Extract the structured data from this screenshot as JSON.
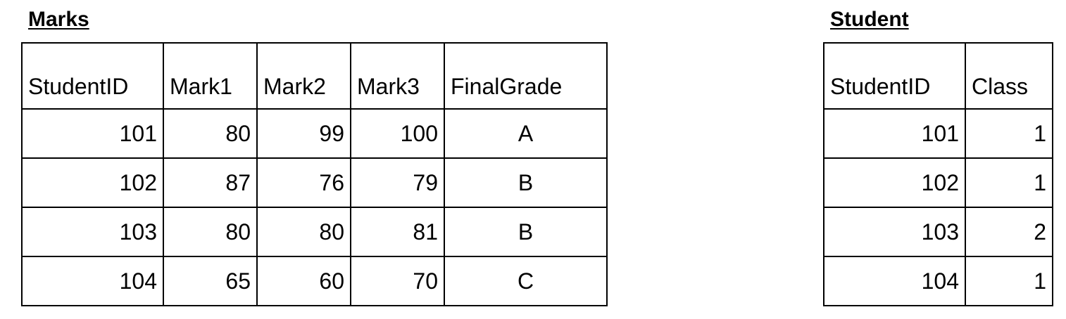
{
  "marks": {
    "title": "Marks",
    "headers": [
      "StudentID",
      "Mark1",
      "Mark2",
      "Mark3",
      "FinalGrade"
    ],
    "rows": [
      [
        "101",
        "80",
        "99",
        "100",
        "A"
      ],
      [
        "102",
        "87",
        "76",
        "79",
        "B"
      ],
      [
        "103",
        "80",
        "80",
        "81",
        "B"
      ],
      [
        "104",
        "65",
        "60",
        "70",
        "C"
      ]
    ]
  },
  "student": {
    "title": "Student",
    "headers": [
      "StudentID",
      "Class"
    ],
    "rows": [
      [
        "101",
        "1"
      ],
      [
        "102",
        "1"
      ],
      [
        "103",
        "2"
      ],
      [
        "104",
        "1"
      ]
    ]
  }
}
